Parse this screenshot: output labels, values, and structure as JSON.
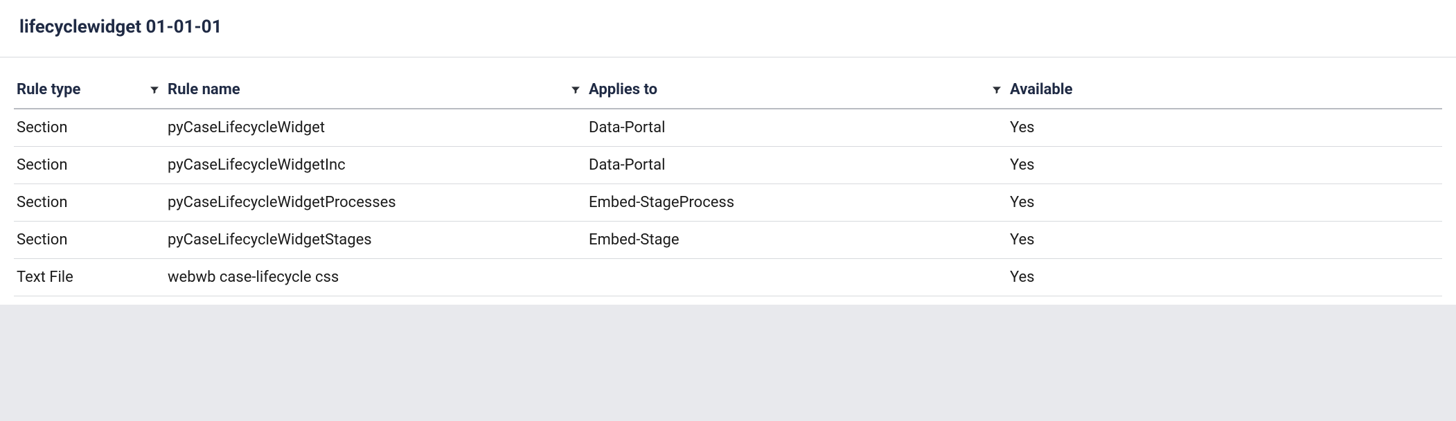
{
  "header": {
    "title": "lifecyclewidget 01-01-01"
  },
  "table": {
    "columns": [
      {
        "label": "Rule type",
        "filter": true
      },
      {
        "label": "Rule name",
        "filter": true
      },
      {
        "label": "Applies to",
        "filter": true
      },
      {
        "label": "Available",
        "filter": false
      }
    ],
    "rows": [
      {
        "type": "Section",
        "name": "pyCaseLifecycleWidget",
        "applies": "Data-Portal",
        "available": "Yes"
      },
      {
        "type": "Section",
        "name": "pyCaseLifecycleWidgetInc",
        "applies": "Data-Portal",
        "available": "Yes"
      },
      {
        "type": "Section",
        "name": "pyCaseLifecycleWidgetProcesses",
        "applies": "Embed-StageProcess",
        "available": "Yes"
      },
      {
        "type": "Section",
        "name": "pyCaseLifecycleWidgetStages",
        "applies": "Embed-Stage",
        "available": "Yes"
      },
      {
        "type": "Text File",
        "name": "webwb case-lifecycle css",
        "applies": "",
        "available": "Yes"
      }
    ]
  }
}
